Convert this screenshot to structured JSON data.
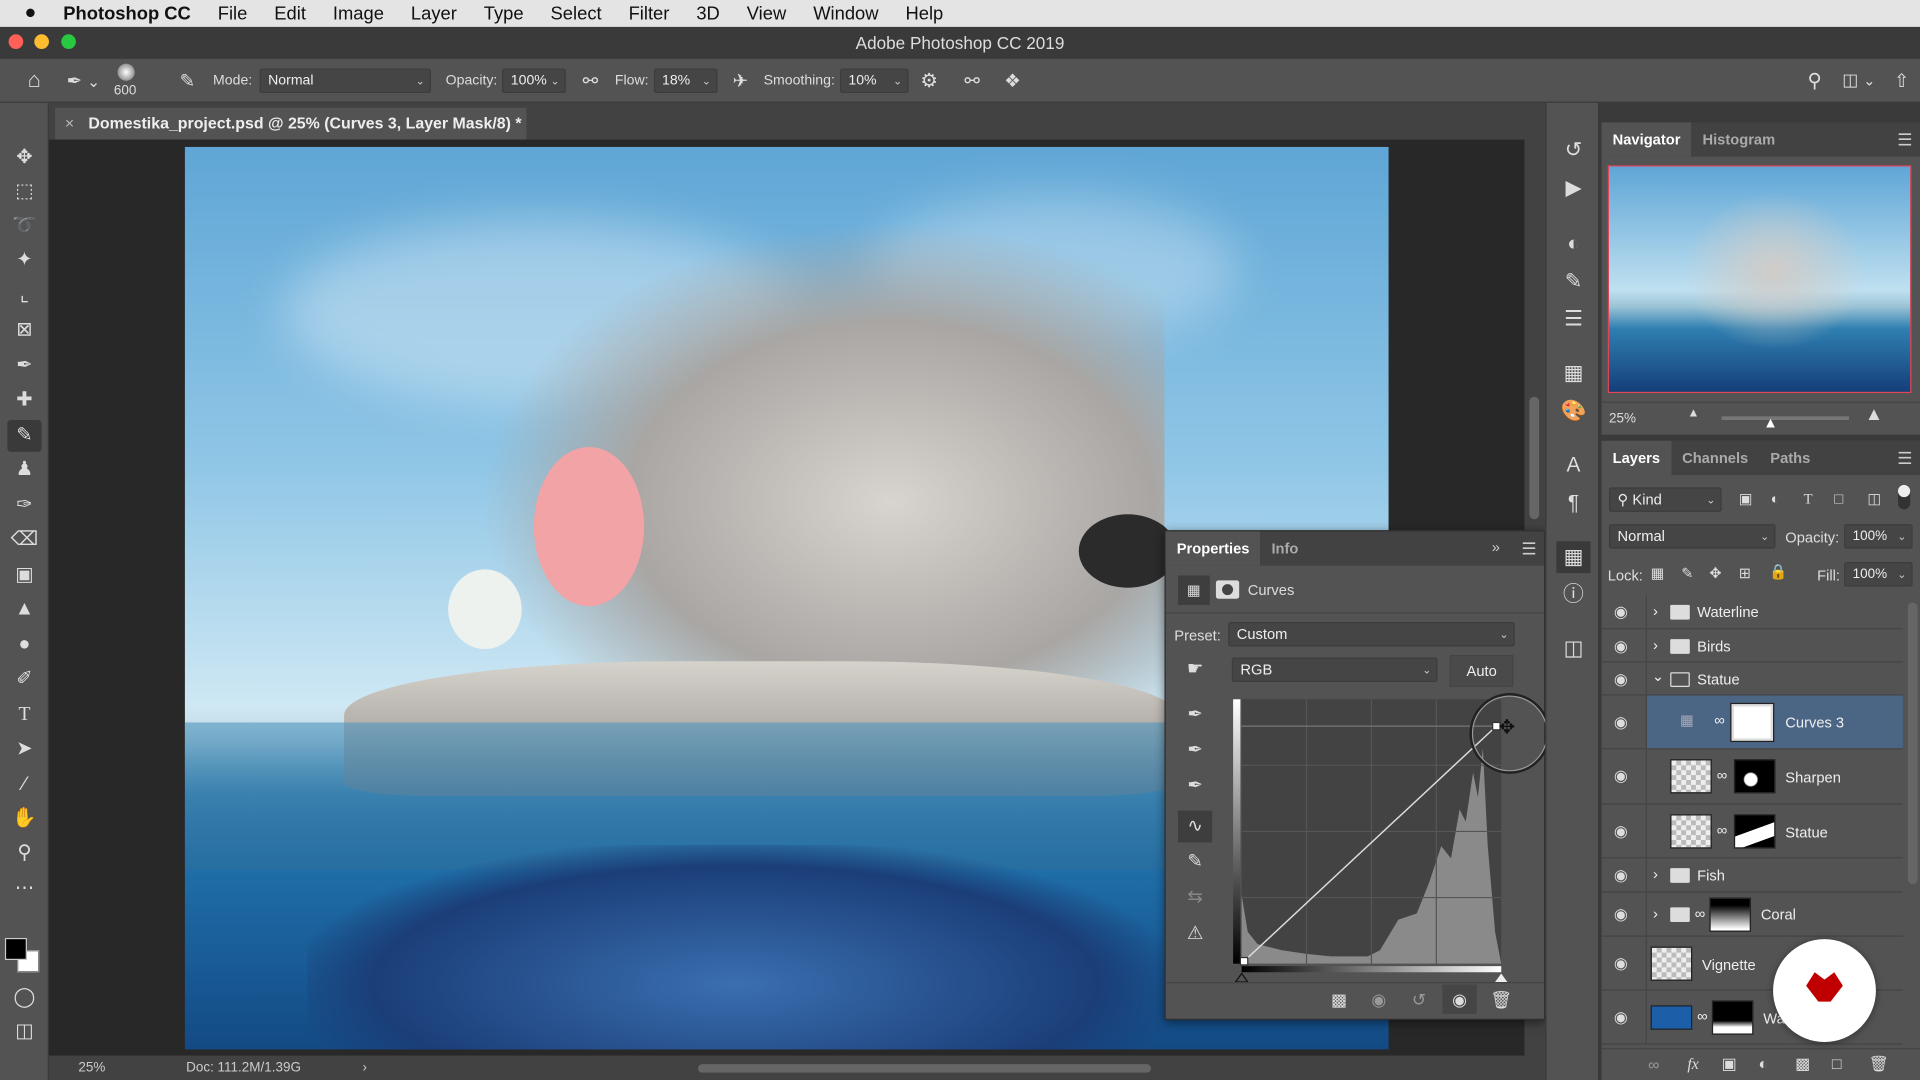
{
  "menubar": {
    "app": "Photoshop CC",
    "items": [
      "File",
      "Edit",
      "Image",
      "Layer",
      "Type",
      "Select",
      "Filter",
      "3D",
      "View",
      "Window",
      "Help"
    ]
  },
  "window": {
    "title": "Adobe Photoshop CC 2019"
  },
  "options": {
    "brush_size": "600",
    "mode_label": "Mode:",
    "mode": "Normal",
    "opacity_label": "Opacity:",
    "opacity": "100%",
    "flow_label": "Flow:",
    "flow": "18%",
    "smoothing_label": "Smoothing:",
    "smoothing": "10%"
  },
  "document": {
    "tab": "Domestika_project.psd @ 25% (Curves 3, Layer Mask/8) *",
    "zoom": "25%",
    "doc_info": "Doc: 111.2M/1.39G"
  },
  "navigator": {
    "tabs": [
      "Navigator",
      "Histogram"
    ],
    "zoom": "25%",
    "zoom_slider_fraction": 0.4
  },
  "layers_panel": {
    "tabs": [
      "Layers",
      "Channels",
      "Paths"
    ],
    "filter": "Kind",
    "blend_mode": "Normal",
    "opacity_label": "Opacity:",
    "opacity": "100%",
    "lock_label": "Lock:",
    "fill_label": "Fill:",
    "fill": "100%",
    "layers": [
      {
        "name": "Waterline",
        "type": "group"
      },
      {
        "name": "Birds",
        "type": "group"
      },
      {
        "name": "Statue",
        "type": "group-open"
      },
      {
        "name": "Curves 3",
        "type": "adjustment",
        "selected": true
      },
      {
        "name": "Sharpen",
        "type": "pixel-mask"
      },
      {
        "name": "Statue",
        "type": "pixel-mask"
      },
      {
        "name": "Fish",
        "type": "group"
      },
      {
        "name": "Coral",
        "type": "group-mask"
      },
      {
        "name": "Vignette",
        "type": "pixel"
      },
      {
        "name": "Wa",
        "type": "pixel-mask"
      }
    ]
  },
  "properties": {
    "tabs": [
      "Properties",
      "Info"
    ],
    "type": "Curves",
    "preset_label": "Preset:",
    "preset": "Custom",
    "channel": "RGB",
    "auto_label": "Auto"
  },
  "colors": {
    "accent_selected": "#4b6584",
    "panel": "#535353",
    "traffic_red": "#fe5f57",
    "traffic_yellow": "#febc2e",
    "traffic_green": "#28c840",
    "watermark": "#c00000"
  }
}
